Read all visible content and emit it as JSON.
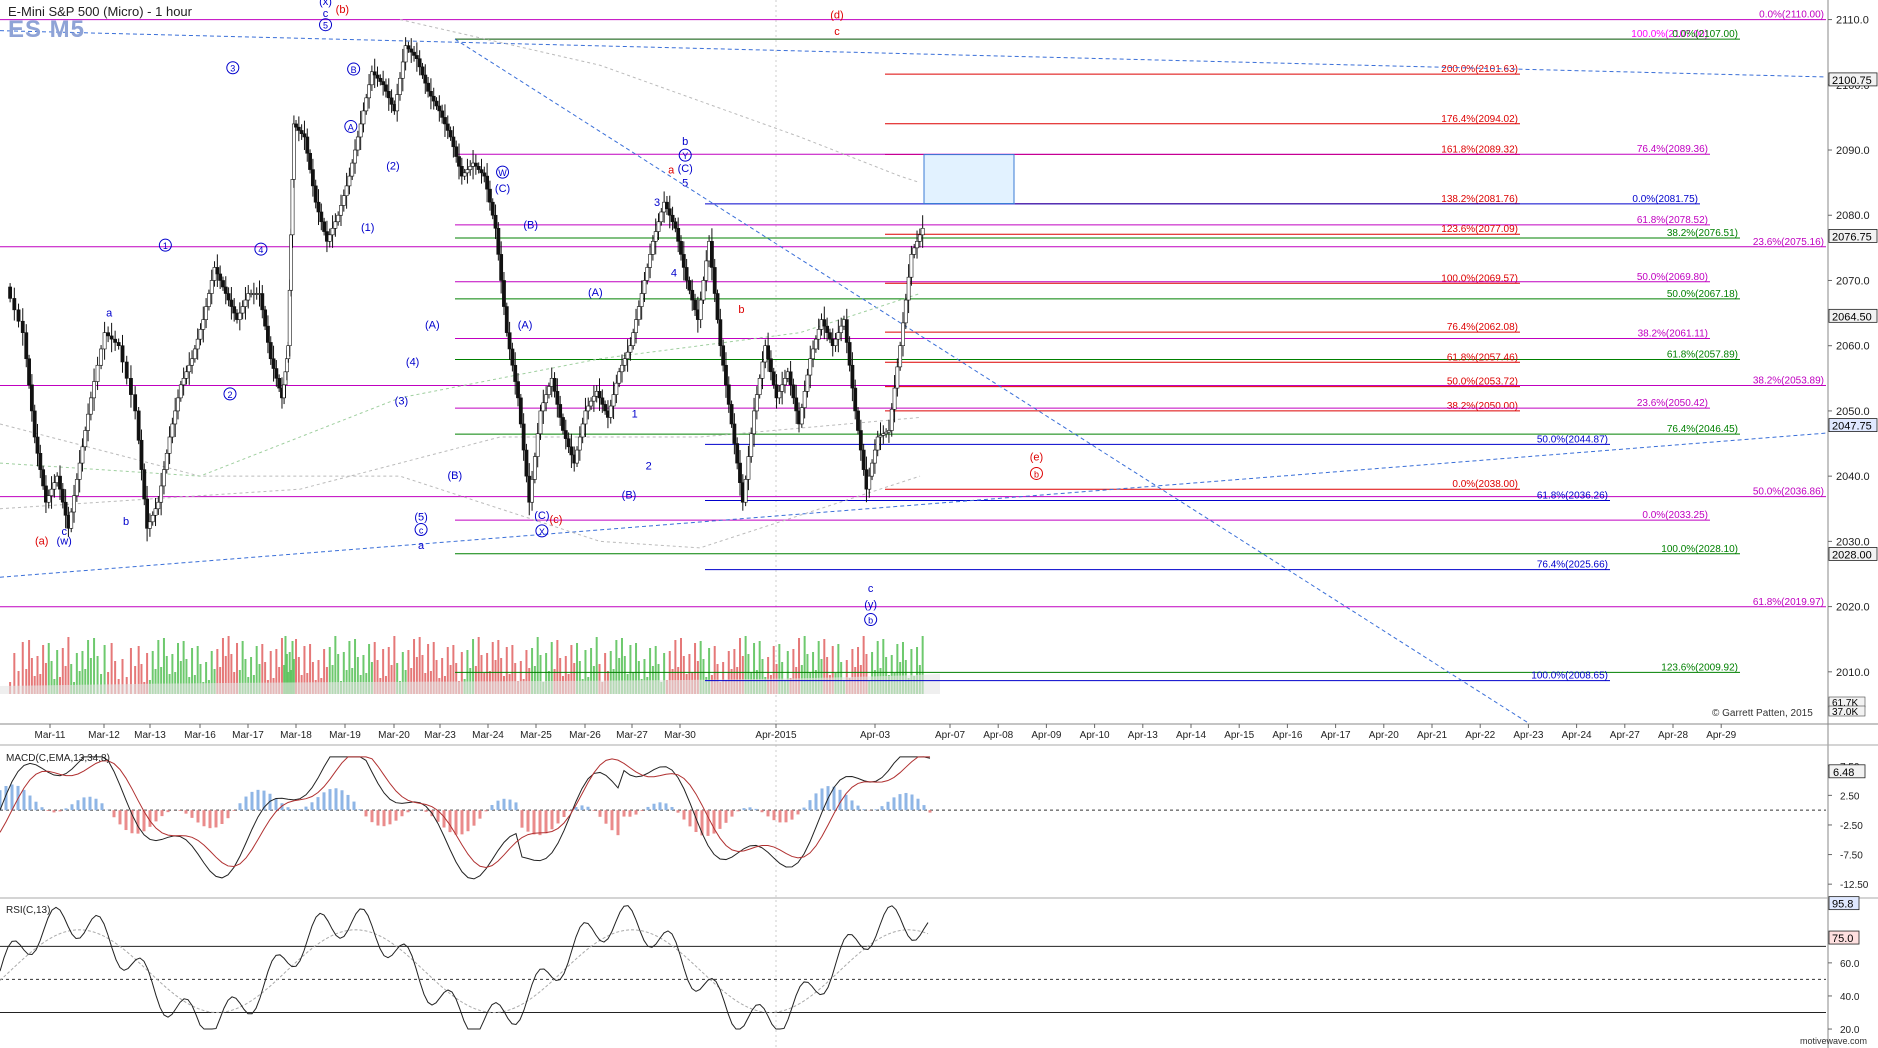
{
  "header": {
    "title": "E-Mini S&P 500 (Micro)  - 1 hour",
    "symbol": "ES M5"
  },
  "copyright": "© Garrett Patten, 2015",
  "watermark": "motivewave.com",
  "chart_data": {
    "type": "candlestick",
    "price_axis": {
      "ylim": [
        2002,
        2113
      ],
      "ticks": [
        2010,
        2020,
        2030,
        2040,
        2050,
        2060,
        2070,
        2080,
        2090,
        2100,
        2110
      ],
      "price_badges": [
        {
          "text": "2100.75",
          "value": 2100.75,
          "style": "black"
        },
        {
          "text": "2076.75",
          "value": 2076.75,
          "style": "black"
        },
        {
          "text": "2064.50",
          "value": 2064.5,
          "style": "black"
        },
        {
          "text": "2047.75",
          "value": 2047.75,
          "style": "blue"
        },
        {
          "text": "2028.00",
          "value": 2028.0,
          "style": "black"
        }
      ],
      "volume_badges": [
        "61.7K",
        "37.0K"
      ]
    },
    "time_axis": [
      "Mar-11",
      "Mar-12",
      "Mar-13",
      "Mar-16",
      "Mar-17",
      "Mar-18",
      "Mar-19",
      "Mar-20",
      "Mar-23",
      "Mar-24",
      "Mar-25",
      "Mar-26",
      "Mar-27",
      "Mar-30",
      "Apr-2015",
      "Apr-03",
      "Apr-07",
      "Apr-08",
      "Apr-09",
      "Apr-10",
      "Apr-13",
      "Apr-14",
      "Apr-15",
      "Apr-16",
      "Apr-17",
      "Apr-20",
      "Apr-21",
      "Apr-22",
      "Apr-23",
      "Apr-24",
      "Apr-27",
      "Apr-28",
      "Apr-29"
    ],
    "price_path": [
      [
        0,
        2069
      ],
      [
        0.6,
        2062
      ],
      [
        1.0,
        2046
      ],
      [
        1.4,
        2036
      ],
      [
        1.8,
        2040
      ],
      [
        2.2,
        2032
      ],
      [
        2.6,
        2042
      ],
      [
        3.0,
        2052
      ],
      [
        3.5,
        2062
      ],
      [
        4.0,
        2060
      ],
      [
        4.6,
        2050
      ],
      [
        5.0,
        2032
      ],
      [
        5.4,
        2036
      ],
      [
        5.8,
        2046
      ],
      [
        6.2,
        2054
      ],
      [
        6.6,
        2058
      ],
      [
        7.0,
        2064
      ],
      [
        7.4,
        2072
      ],
      [
        7.8,
        2068
      ],
      [
        8.2,
        2064
      ],
      [
        8.6,
        2068
      ],
      [
        9.0,
        2068
      ],
      [
        9.4,
        2058
      ],
      [
        9.8,
        2052
      ],
      [
        10.0,
        2060
      ],
      [
        10.2,
        2094
      ],
      [
        10.6,
        2092
      ],
      [
        11.0,
        2082
      ],
      [
        11.4,
        2076
      ],
      [
        11.8,
        2080
      ],
      [
        12.2,
        2086
      ],
      [
        12.6,
        2094
      ],
      [
        13.0,
        2102
      ],
      [
        13.4,
        2100
      ],
      [
        13.8,
        2096
      ],
      [
        14.2,
        2106
      ],
      [
        14.6,
        2104
      ],
      [
        15.0,
        2099
      ],
      [
        15.4,
        2096
      ],
      [
        15.8,
        2092
      ],
      [
        16.2,
        2086
      ],
      [
        16.6,
        2088
      ],
      [
        17.0,
        2086
      ],
      [
        17.4,
        2078
      ],
      [
        17.8,
        2062
      ],
      [
        18.2,
        2052
      ],
      [
        18.6,
        2036
      ],
      [
        19.0,
        2050
      ],
      [
        19.4,
        2055
      ],
      [
        19.8,
        2047
      ],
      [
        20.2,
        2042
      ],
      [
        20.6,
        2050
      ],
      [
        21.0,
        2053
      ],
      [
        21.4,
        2049
      ],
      [
        21.8,
        2056
      ],
      [
        22.2,
        2060
      ],
      [
        22.6,
        2068
      ],
      [
        23.0,
        2076
      ],
      [
        23.4,
        2082
      ],
      [
        23.8,
        2078
      ],
      [
        24.2,
        2070
      ],
      [
        24.6,
        2064
      ],
      [
        25.0,
        2076
      ],
      [
        25.4,
        2060
      ],
      [
        25.8,
        2048
      ],
      [
        26.2,
        2036
      ],
      [
        26.6,
        2050
      ],
      [
        27.0,
        2060
      ],
      [
        27.4,
        2052
      ],
      [
        27.8,
        2056
      ],
      [
        28.2,
        2048
      ],
      [
        28.6,
        2058
      ],
      [
        29.0,
        2064
      ],
      [
        29.4,
        2060
      ],
      [
        29.8,
        2064
      ],
      [
        30.2,
        2050
      ],
      [
        30.6,
        2038
      ],
      [
        31.0,
        2046
      ],
      [
        31.4,
        2047
      ],
      [
        31.8,
        2060
      ],
      [
        32.2,
        2074
      ],
      [
        32.6,
        2078
      ]
    ],
    "fib_labels": [
      {
        "text": "0.0%(2110.00)",
        "value": 2110.0,
        "color": "#c000c0"
      },
      {
        "text": "100.0%(2107.00)",
        "value": 2107.0,
        "color": "#ff00ff"
      },
      {
        "text": "0.0%(2107.00)",
        "value": 2107.0,
        "color": "#008000"
      },
      {
        "text": "200.0%(2101.63)",
        "value": 2101.63,
        "color": "#dd0000"
      },
      {
        "text": "176.4%(2094.02)",
        "value": 2094.02,
        "color": "#dd0000"
      },
      {
        "text": "161.8%(2089.32)",
        "value": 2089.32,
        "color": "#dd0000"
      },
      {
        "text": "76.4%(2089.36)",
        "value": 2089.36,
        "color": "#c000c0"
      },
      {
        "text": "138.2%(2081.76)",
        "value": 2081.76,
        "color": "#dd0000"
      },
      {
        "text": "0.0%(2081.75)",
        "value": 2081.75,
        "color": "#0000cc"
      },
      {
        "text": "61.8%(2078.52)",
        "value": 2078.52,
        "color": "#c000c0"
      },
      {
        "text": "123.6%(2077.09)",
        "value": 2077.09,
        "color": "#dd0000"
      },
      {
        "text": "38.2%(2076.51)",
        "value": 2076.51,
        "color": "#008000"
      },
      {
        "text": "23.6%(2075.16)",
        "value": 2075.16,
        "color": "#c000c0"
      },
      {
        "text": "100.0%(2069.57)",
        "value": 2069.57,
        "color": "#dd0000"
      },
      {
        "text": "50.0%(2069.80)",
        "value": 2069.8,
        "color": "#c000c0"
      },
      {
        "text": "50.0%(2067.18)",
        "value": 2067.18,
        "color": "#008000"
      },
      {
        "text": "76.4%(2062.08)",
        "value": 2062.08,
        "color": "#dd0000"
      },
      {
        "text": "38.2%(2061.11)",
        "value": 2061.11,
        "color": "#c000c0"
      },
      {
        "text": "61.8%(2057.89)",
        "value": 2057.89,
        "color": "#008000"
      },
      {
        "text": "61.8%(2057.46)",
        "value": 2057.46,
        "color": "#dd0000"
      },
      {
        "text": "50.0%(2053.72)",
        "value": 2053.72,
        "color": "#dd0000"
      },
      {
        "text": "38.2%(2053.89)",
        "value": 2053.89,
        "color": "#c000c0"
      },
      {
        "text": "38.2%(2050.00)",
        "value": 2050.0,
        "color": "#dd0000"
      },
      {
        "text": "23.6%(2050.42)",
        "value": 2050.42,
        "color": "#c000c0"
      },
      {
        "text": "76.4%(2046.45)",
        "value": 2046.45,
        "color": "#008000"
      },
      {
        "text": "50.0%(2044.87)",
        "value": 2044.87,
        "color": "#0000cc"
      },
      {
        "text": "0.0%(2038.00)",
        "value": 2038.0,
        "color": "#dd0000"
      },
      {
        "text": "50.0%(2036.86)",
        "value": 2036.86,
        "color": "#c000c0"
      },
      {
        "text": "61.8%(2036.26)",
        "value": 2036.26,
        "color": "#0000cc"
      },
      {
        "text": "0.0%(2033.25)",
        "value": 2033.25,
        "color": "#c000c0"
      },
      {
        "text": "100.0%(2028.10)",
        "value": 2028.1,
        "color": "#008000"
      },
      {
        "text": "76.4%(2025.66)",
        "value": 2025.66,
        "color": "#0000cc"
      },
      {
        "text": "61.8%(2019.97)",
        "value": 2019.97,
        "color": "#c000c0"
      },
      {
        "text": "123.6%(2009.92)",
        "value": 2009.92,
        "color": "#008000"
      },
      {
        "text": "100.0%(2008.65)",
        "value": 2008.65,
        "color": "#0000cc"
      }
    ],
    "wave_labels": [
      {
        "text": "(a)",
        "x": 1.2,
        "value": 2029.5,
        "color": "#dd0000"
      },
      {
        "text": "c",
        "x": 2.0,
        "value": 2031.0,
        "color": "#0000cc"
      },
      {
        "text": "(w)",
        "x": 2.0,
        "value": 2029.5,
        "color": "#0000cc"
      },
      {
        "text": "a",
        "x": 3.6,
        "value": 2064.5,
        "color": "#0000cc"
      },
      {
        "text": "b",
        "x": 4.2,
        "value": 2032.5,
        "color": "#0000cc"
      },
      {
        "text": "1",
        "x": 5.6,
        "value": 2074.8,
        "color": "#0000cc",
        "circled": true
      },
      {
        "text": "2",
        "x": 7.9,
        "value": 2052.0,
        "color": "#0000cc",
        "circled": true
      },
      {
        "text": "3",
        "x": 8.0,
        "value": 2102.0,
        "color": "#0000cc",
        "circled": true
      },
      {
        "text": "4",
        "x": 9.0,
        "value": 2074.2,
        "color": "#0000cc",
        "circled": true
      },
      {
        "text": "(x)",
        "x": 11.3,
        "value": 2112.2,
        "color": "#0000cc"
      },
      {
        "text": "c",
        "x": 11.3,
        "value": 2110.4,
        "color": "#0000cc"
      },
      {
        "text": "(b)",
        "x": 11.9,
        "value": 2111.0,
        "color": "#dd0000"
      },
      {
        "text": "5",
        "x": 11.3,
        "value": 2108.6,
        "color": "#0000cc",
        "circled": true
      },
      {
        "text": "B",
        "x": 12.3,
        "value": 2101.8,
        "color": "#0000cc",
        "circled": true
      },
      {
        "text": "A",
        "x": 12.2,
        "value": 2093.0,
        "color": "#0000cc",
        "circled": true
      },
      {
        "text": "(2)",
        "x": 13.7,
        "value": 2087.0,
        "color": "#0000cc"
      },
      {
        "text": "(1)",
        "x": 12.8,
        "value": 2077.6,
        "color": "#0000cc"
      },
      {
        "text": "(4)",
        "x": 14.4,
        "value": 2057.0,
        "color": "#0000cc"
      },
      {
        "text": "(3)",
        "x": 14.0,
        "value": 2051.0,
        "color": "#0000cc"
      },
      {
        "text": "(A)",
        "x": 15.1,
        "value": 2062.6,
        "color": "#0000cc"
      },
      {
        "text": "(B)",
        "x": 15.9,
        "value": 2039.6,
        "color": "#0000cc"
      },
      {
        "text": "(5)",
        "x": 14.7,
        "value": 2033.2,
        "color": "#0000cc"
      },
      {
        "text": "c",
        "x": 14.7,
        "value": 2031.2,
        "color": "#0000cc",
        "circled": true
      },
      {
        "text": "a",
        "x": 14.7,
        "value": 2028.8,
        "color": "#0000cc"
      },
      {
        "text": "W",
        "x": 17.6,
        "value": 2086.0,
        "color": "#0000cc",
        "circled": true
      },
      {
        "text": "(C)",
        "x": 17.6,
        "value": 2083.6,
        "color": "#0000cc"
      },
      {
        "text": "(B)",
        "x": 18.6,
        "value": 2078.0,
        "color": "#0000cc"
      },
      {
        "text": "(A)",
        "x": 18.4,
        "value": 2062.6,
        "color": "#0000cc"
      },
      {
        "text": "(C)",
        "x": 19.0,
        "value": 2033.4,
        "color": "#0000cc"
      },
      {
        "text": "(c)",
        "x": 19.5,
        "value": 2032.8,
        "color": "#dd0000"
      },
      {
        "text": "X",
        "x": 19.0,
        "value": 2031.0,
        "color": "#0000cc",
        "circled": true
      },
      {
        "text": "(A)",
        "x": 20.9,
        "value": 2067.6,
        "color": "#0000cc"
      },
      {
        "text": "(B)",
        "x": 22.1,
        "value": 2036.6,
        "color": "#0000cc"
      },
      {
        "text": "1",
        "x": 22.3,
        "value": 2049.0,
        "color": "#0000cc"
      },
      {
        "text": "2",
        "x": 22.8,
        "value": 2041.0,
        "color": "#0000cc"
      },
      {
        "text": "3",
        "x": 23.1,
        "value": 2081.4,
        "color": "#0000cc"
      },
      {
        "text": "4",
        "x": 23.7,
        "value": 2070.6,
        "color": "#0000cc"
      },
      {
        "text": "b",
        "x": 24.1,
        "value": 2090.8,
        "color": "#0000cc"
      },
      {
        "text": "Y",
        "x": 24.1,
        "value": 2088.6,
        "color": "#0000cc",
        "circled": true
      },
      {
        "text": "a",
        "x": 23.6,
        "value": 2086.4,
        "color": "#dd0000"
      },
      {
        "text": "(C)",
        "x": 24.1,
        "value": 2086.6,
        "color": "#0000cc"
      },
      {
        "text": "5",
        "x": 24.1,
        "value": 2084.4,
        "color": "#0000cc"
      },
      {
        "text": "b",
        "x": 26.1,
        "value": 2065.0,
        "color": "#dd0000"
      },
      {
        "text": "(d)",
        "x": 29.5,
        "value": 2110.2,
        "color": "#dd0000"
      },
      {
        "text": "c",
        "x": 29.5,
        "value": 2107.6,
        "color": "#dd0000"
      },
      {
        "text": "(e)",
        "x": 36.6,
        "value": 2042.4,
        "color": "#dd0000"
      },
      {
        "text": "b",
        "x": 36.6,
        "value": 2039.8,
        "color": "#dd0000",
        "circled": true
      },
      {
        "text": "c",
        "x": 30.7,
        "value": 2022.2,
        "color": "#0000cc"
      },
      {
        "text": "(y)",
        "x": 30.7,
        "value": 2019.8,
        "color": "#0000cc"
      },
      {
        "text": "b",
        "x": 30.7,
        "value": 2017.4,
        "color": "#0000cc",
        "circled": true
      }
    ],
    "macd": {
      "label": "MACD(C,EMA,13,34,8)",
      "ylim": [
        -14.5,
        10.5
      ],
      "ticks": [
        7.5,
        2.5,
        -2.5,
        -7.5,
        -12.5
      ],
      "current_badge": "6.48"
    },
    "rsi": {
      "label": "RSI(C,13)",
      "ylim": [
        17,
        98
      ],
      "ticks": [
        60,
        40,
        20
      ],
      "current_badges": [
        "95.8",
        "75.0"
      ]
    }
  }
}
